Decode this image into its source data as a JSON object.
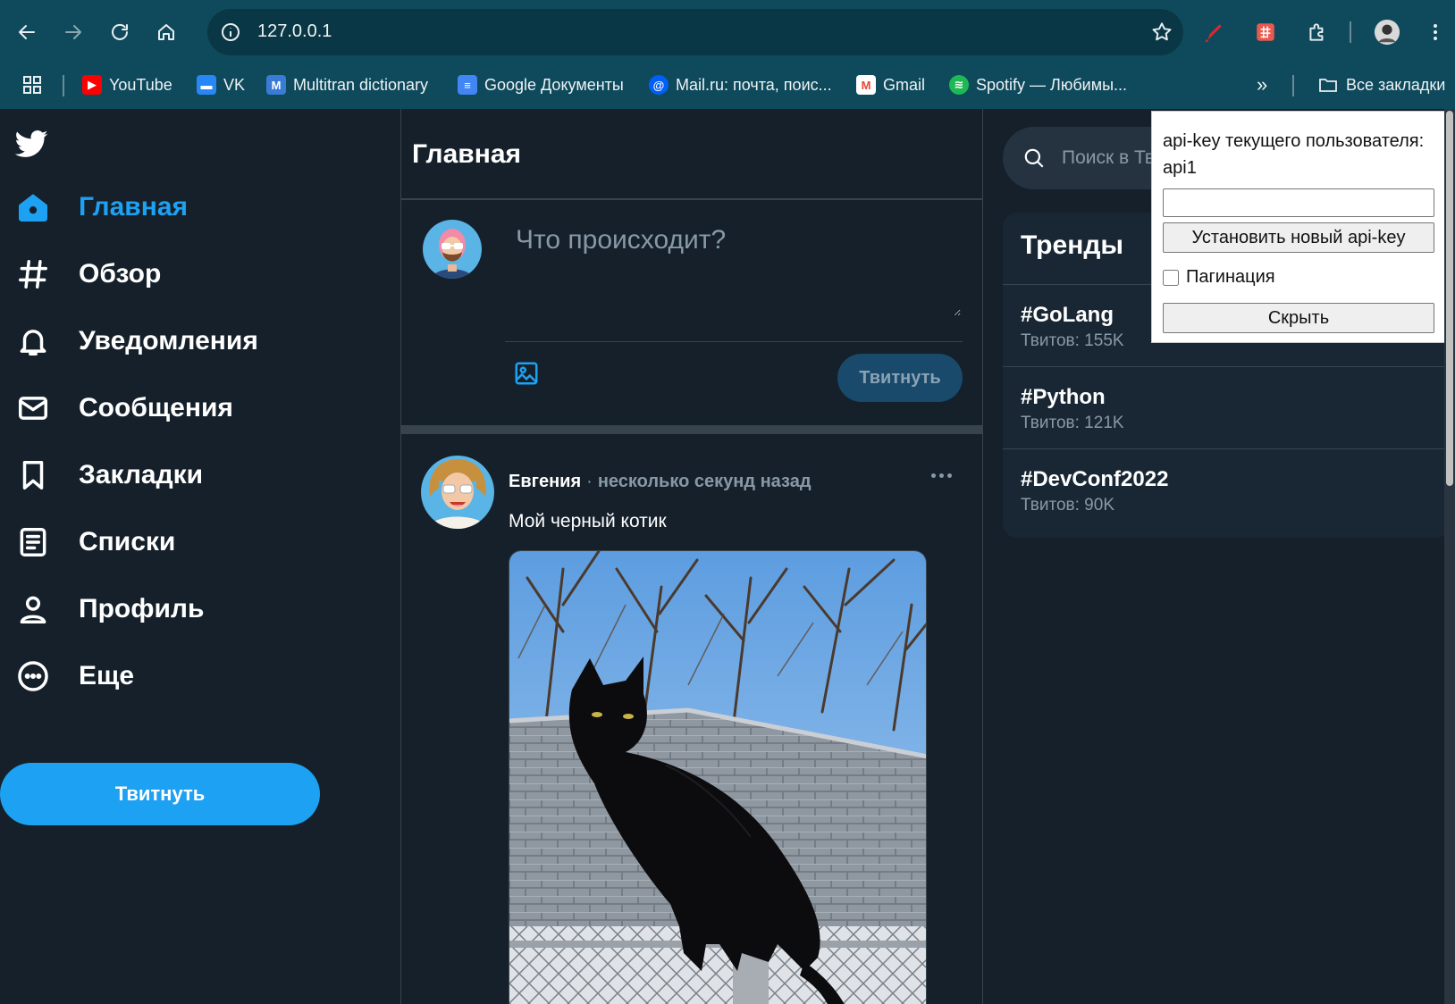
{
  "browser": {
    "url": "127.0.0.1",
    "bookmarks": [
      {
        "label": "YouTube",
        "icon": "youtube-icon",
        "color": "#ff0000"
      },
      {
        "label": "VK",
        "icon": "vk-icon",
        "color": "#2787f5"
      },
      {
        "label": "Multitran dictionary",
        "icon": "multitran-icon",
        "color": "#3a7bd5"
      },
      {
        "label": "Google Документы",
        "icon": "google-docs-icon",
        "color": "#4285f4"
      },
      {
        "label": "Mail.ru: почта, поис...",
        "icon": "mailru-icon",
        "color": "#005ff9"
      },
      {
        "label": "Gmail",
        "icon": "gmail-icon",
        "color": "#ea4335"
      },
      {
        "label": "Spotify — Любимы...",
        "icon": "spotify-icon",
        "color": "#1db954"
      }
    ],
    "more_bookmarks": "»",
    "all_bookmarks": "Все закладки"
  },
  "nav": {
    "items": [
      {
        "label": "Главная",
        "icon": "home-icon",
        "active": true
      },
      {
        "label": "Обзор",
        "icon": "hashtag-icon"
      },
      {
        "label": "Уведомления",
        "icon": "bell-icon"
      },
      {
        "label": "Сообщения",
        "icon": "mail-icon"
      },
      {
        "label": "Закладки",
        "icon": "bookmark-icon"
      },
      {
        "label": "Списки",
        "icon": "list-icon"
      },
      {
        "label": "Профиль",
        "icon": "profile-icon"
      },
      {
        "label": "Еще",
        "icon": "more-icon"
      }
    ],
    "tweet_button": "Твитнуть"
  },
  "main": {
    "title": "Главная",
    "composer": {
      "placeholder": "Что происходит?",
      "tweet_button": "Твитнуть"
    },
    "tweet": {
      "author": "Евгения",
      "separator": "·",
      "time": "несколько секунд назад",
      "text": "Мой черный котик"
    }
  },
  "sidebar": {
    "search_placeholder": "Поиск в Твиттере",
    "trends_title": "Тренды",
    "trends": [
      {
        "tag": "#GoLang",
        "count": "Твитов: 155K"
      },
      {
        "tag": "#Python",
        "count": "Твитов: 121K"
      },
      {
        "tag": "#DevConf2022",
        "count": "Твитов: 90K"
      }
    ]
  },
  "apikey_panel": {
    "label": "api-key текущего пользователя: api1",
    "input_value": "",
    "set_button": "Установить новый api-key",
    "pagination_label": "Пагинация",
    "pagination_checked": false,
    "hide_button": "Скрыть"
  },
  "colors": {
    "accent": "#1da1f2",
    "background": "#15202b",
    "chrome": "#0f4a5c"
  }
}
